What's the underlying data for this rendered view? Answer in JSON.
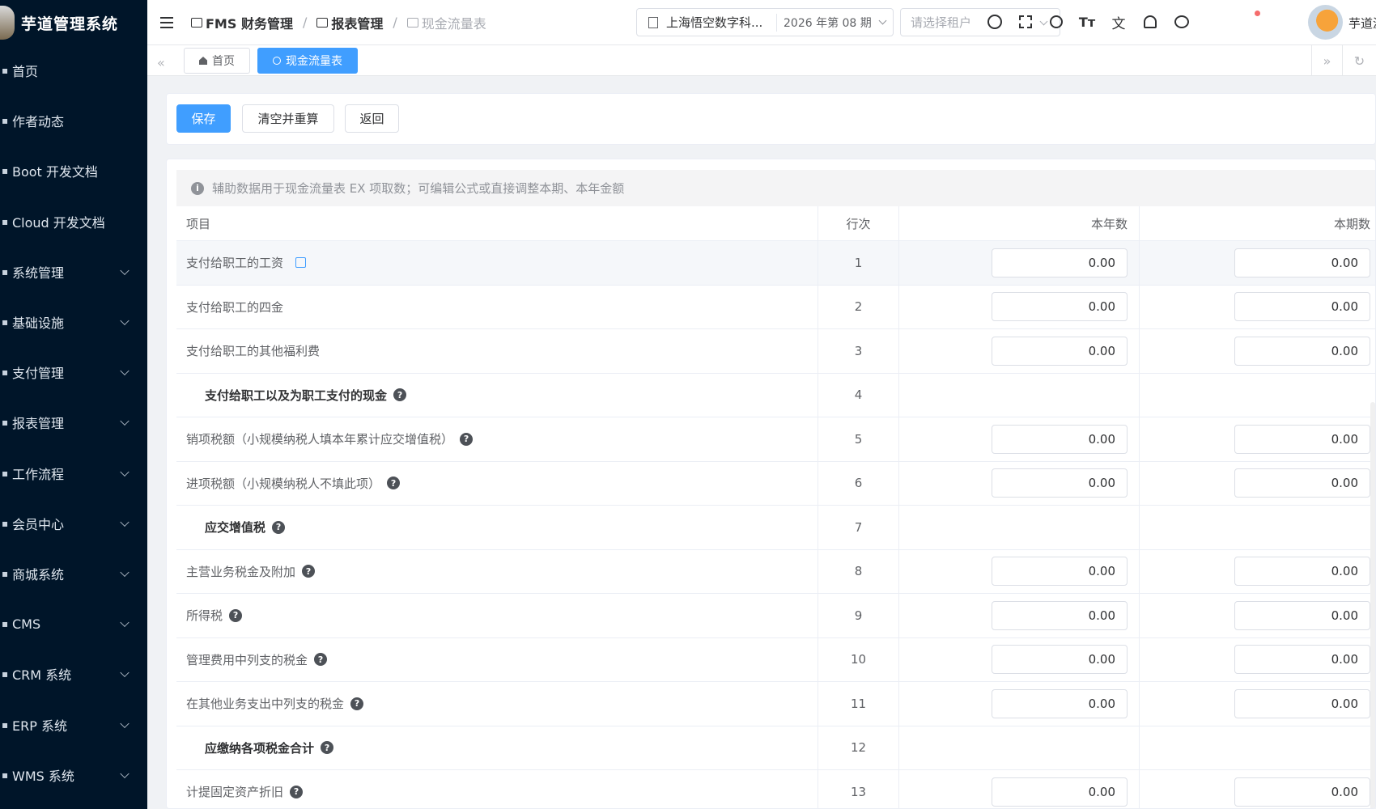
{
  "app": {
    "title": "芋道管理系统"
  },
  "sidebar": {
    "items": [
      {
        "label": "首页",
        "expandable": false
      },
      {
        "label": "作者动态",
        "expandable": false
      },
      {
        "label": "Boot 开发文档",
        "expandable": false
      },
      {
        "label": "Cloud 开发文档",
        "expandable": false
      },
      {
        "label": "系统管理",
        "expandable": true
      },
      {
        "label": "基础设施",
        "expandable": true
      },
      {
        "label": "支付管理",
        "expandable": true
      },
      {
        "label": "报表管理",
        "expandable": true
      },
      {
        "label": "工作流程",
        "expandable": true
      },
      {
        "label": "会员中心",
        "expandable": true
      },
      {
        "label": "商城系统",
        "expandable": true
      },
      {
        "label": "CMS",
        "expandable": true
      },
      {
        "label": "CRM 系统",
        "expandable": true
      },
      {
        "label": "ERP 系统",
        "expandable": true
      },
      {
        "label": "WMS 系统",
        "expandable": true
      }
    ]
  },
  "header": {
    "breadcrumb": [
      "FMS 财务管理",
      "报表管理",
      "现金流量表"
    ],
    "tenant_name": "上海悟空数字科...",
    "period": "2026 年第 08 期",
    "tenant_placeholder": "请选择租户",
    "user_name": "芋道源",
    "notification_dot_color": "#f56c6c"
  },
  "tabs": [
    {
      "label": "首页",
      "active": false,
      "icon": "home-icon"
    },
    {
      "label": "现金流量表",
      "active": true,
      "icon": "database-icon"
    }
  ],
  "toolbar": {
    "save_label": "保存",
    "clear_recalc_label": "清空并重算",
    "back_label": "返回"
  },
  "tip": "辅助数据用于现金流量表 EX 项取数；可编辑公式或直接调整本期、本年金额",
  "table": {
    "headers": {
      "item": "项目",
      "line": "行次",
      "year": "本年数",
      "period": "本期数"
    },
    "rows": [
      {
        "item": "支付给职工的工资",
        "line": "1",
        "year": "0.00",
        "period": "0.00",
        "subtotal": false,
        "help": false,
        "edit": true
      },
      {
        "item": "支付给职工的四金",
        "line": "2",
        "year": "0.00",
        "period": "0.00",
        "subtotal": false,
        "help": false,
        "edit": false
      },
      {
        "item": "支付给职工的其他福利费",
        "line": "3",
        "year": "0.00",
        "period": "0.00",
        "subtotal": false,
        "help": false,
        "edit": false
      },
      {
        "item": "支付给职工以及为职工支付的现金",
        "line": "4",
        "year": "",
        "period": "",
        "subtotal": true,
        "help": true,
        "edit": false
      },
      {
        "item": "销项税额（小规模纳税人填本年累计应交增值税）",
        "line": "5",
        "year": "0.00",
        "period": "0.00",
        "subtotal": false,
        "help": true,
        "edit": false
      },
      {
        "item": "进项税额（小规模纳税人不填此项）",
        "line": "6",
        "year": "0.00",
        "period": "0.00",
        "subtotal": false,
        "help": true,
        "edit": false
      },
      {
        "item": "应交增值税",
        "line": "7",
        "year": "",
        "period": "",
        "subtotal": true,
        "help": true,
        "edit": false
      },
      {
        "item": "主营业务税金及附加",
        "line": "8",
        "year": "0.00",
        "period": "0.00",
        "subtotal": false,
        "help": true,
        "edit": false
      },
      {
        "item": "所得税",
        "line": "9",
        "year": "0.00",
        "period": "0.00",
        "subtotal": false,
        "help": true,
        "edit": false
      },
      {
        "item": "管理费用中列支的税金",
        "line": "10",
        "year": "0.00",
        "period": "0.00",
        "subtotal": false,
        "help": true,
        "edit": false
      },
      {
        "item": "在其他业务支出中列支的税金",
        "line": "11",
        "year": "0.00",
        "period": "0.00",
        "subtotal": false,
        "help": true,
        "edit": false
      },
      {
        "item": "应缴纳各项税金合计",
        "line": "12",
        "year": "",
        "period": "",
        "subtotal": true,
        "help": true,
        "edit": false
      },
      {
        "item": "计提固定资产折旧",
        "line": "13",
        "year": "0.00",
        "period": "0.00",
        "subtotal": false,
        "help": true,
        "edit": false
      }
    ]
  },
  "colors": {
    "primary": "#409eff",
    "sidebar_bg": "#001529"
  }
}
